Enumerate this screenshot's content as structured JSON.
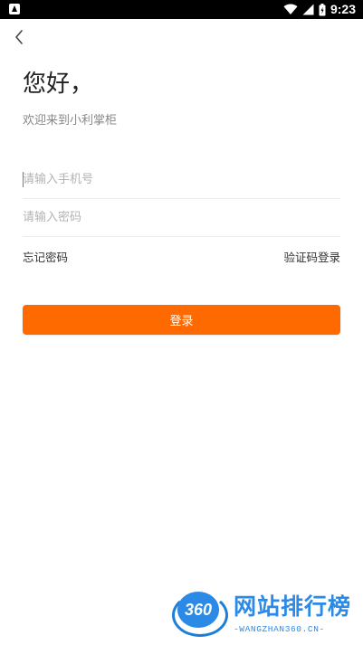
{
  "status_bar": {
    "time": "9:23"
  },
  "header": {
    "back_icon": "chevron-left-icon"
  },
  "greeting": {
    "title": "您好，",
    "subtitle": "欢迎来到小利掌柜"
  },
  "form": {
    "phone_placeholder": "请输入手机号",
    "password_placeholder": "请输入密码",
    "forgot_label": "忘记密码",
    "code_login_label": "验证码登录",
    "login_label": "登录"
  },
  "watermark": {
    "badge": "360",
    "name": "网站排行榜",
    "url": "-WANGZHAN360.CN-"
  },
  "colors": {
    "accent": "#ff6a00",
    "watermark_blue": "#2a8ae6"
  }
}
